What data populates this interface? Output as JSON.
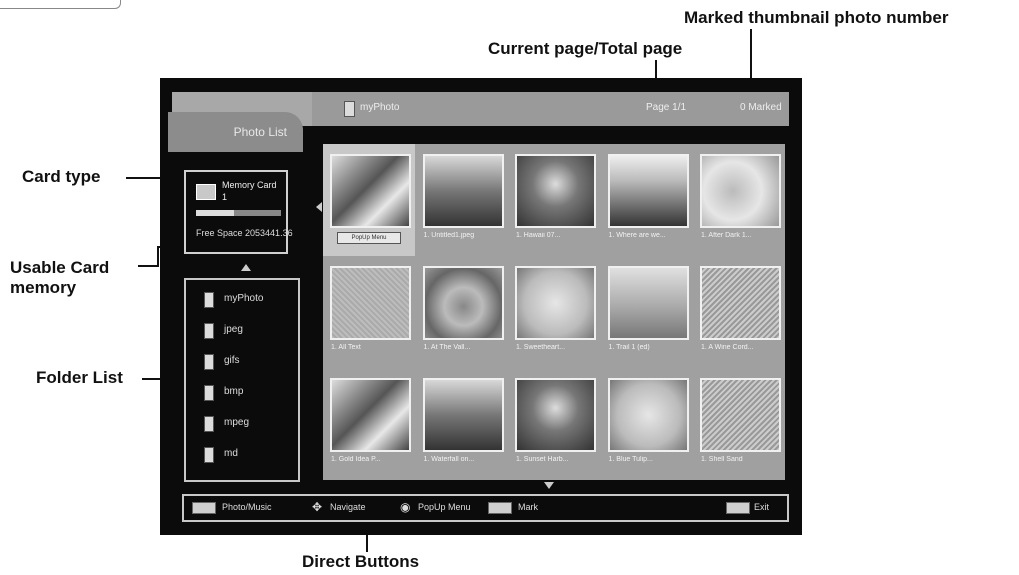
{
  "callouts": {
    "marked_thumbnail": "Marked thumbnail photo number",
    "current_page": "Current page/Total page",
    "card_type": "Card type",
    "usable_memory_line1": "Usable Card",
    "usable_memory_line2": "memory",
    "folder_list": "Folder List",
    "direct_buttons": "Direct Buttons"
  },
  "screen": {
    "tab_label": "Photo List",
    "path": "myPhoto",
    "page_indicator": "Page 1/1",
    "marked_count": "0 Marked"
  },
  "card": {
    "name": "Memory Card",
    "number": "1",
    "free_space": "Free Space 2053441.36",
    "used_fraction": 0.45
  },
  "folders": [
    {
      "name": "myPhoto"
    },
    {
      "name": "jpeg"
    },
    {
      "name": "gifs"
    },
    {
      "name": "bmp"
    },
    {
      "name": "mpeg"
    },
    {
      "name": "md"
    }
  ],
  "thumbnails": [
    {
      "label": "PopUp Menu",
      "tone": "tone-a",
      "selected": true
    },
    {
      "label": "1. Untitled1.jpeg",
      "tone": "tone-b"
    },
    {
      "label": "1. Hawaii 07...",
      "tone": "tone-c"
    },
    {
      "label": "1. Where are we...",
      "tone": "tone-d"
    },
    {
      "label": "1. After Dark 1...",
      "tone": "tone-e"
    },
    {
      "label": "1. All Text",
      "tone": "tone-f"
    },
    {
      "label": "1. At The Vall...",
      "tone": "tone-g"
    },
    {
      "label": "1. Sweetheart...",
      "tone": "tone-h"
    },
    {
      "label": "1. Trail 1 (ed)",
      "tone": "tone-i"
    },
    {
      "label": "1. A Wine Cord...",
      "tone": "tone-j"
    },
    {
      "label": "1. Gold Idea P...",
      "tone": "tone-a"
    },
    {
      "label": "1. Waterfall on...",
      "tone": "tone-b"
    },
    {
      "label": "1. Sunset Harb...",
      "tone": "tone-c"
    },
    {
      "label": "1. Blue Tulip...",
      "tone": "tone-h"
    },
    {
      "label": "1. Shell Sand",
      "tone": "tone-j"
    }
  ],
  "buttons": {
    "photo_music": "Photo/Music",
    "navigate": "Navigate",
    "popup_menu": "PopUp Menu",
    "mark": "Mark",
    "exit": "Exit",
    "navigate_glyph": "✥",
    "popup_glyph": "◉"
  }
}
